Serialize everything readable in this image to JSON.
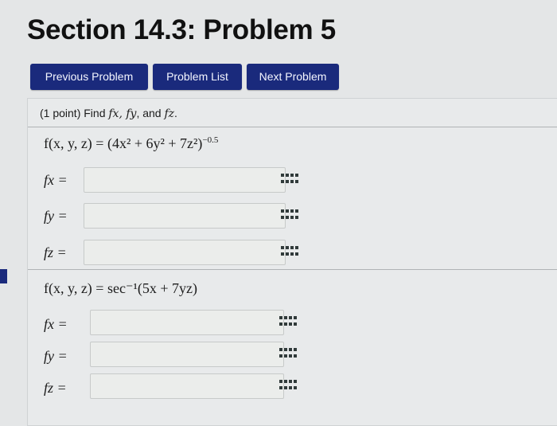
{
  "page": {
    "title": "Section 14.3: Problem 5"
  },
  "nav": {
    "previous_label": "Previous Problem",
    "list_label": "Problem List",
    "next_label": "Next Problem"
  },
  "problem": {
    "intro_prefix": "(1 point) Find ",
    "intro_vars": "fx, fy",
    "intro_and": ", and ",
    "intro_last": "fz",
    "intro_suffix": ".",
    "part1": {
      "function": "f(x, y, z) = (4x² + 6y² + 7z²)",
      "exponent": "−0.5",
      "labels": [
        "fx =",
        "fy =",
        "fz ="
      ],
      "values": [
        "",
        "",
        ""
      ]
    },
    "part2": {
      "function": "f(x, y, z) = sec⁻¹(5x + 7yz)",
      "labels": [
        "fx =",
        "fy =",
        "fz ="
      ],
      "values": [
        "",
        "",
        ""
      ]
    }
  },
  "colors": {
    "nav_button": "#1a2a7c",
    "background": "#e4e6e7"
  },
  "icons": {
    "answer_tool": "matrix-icon"
  }
}
